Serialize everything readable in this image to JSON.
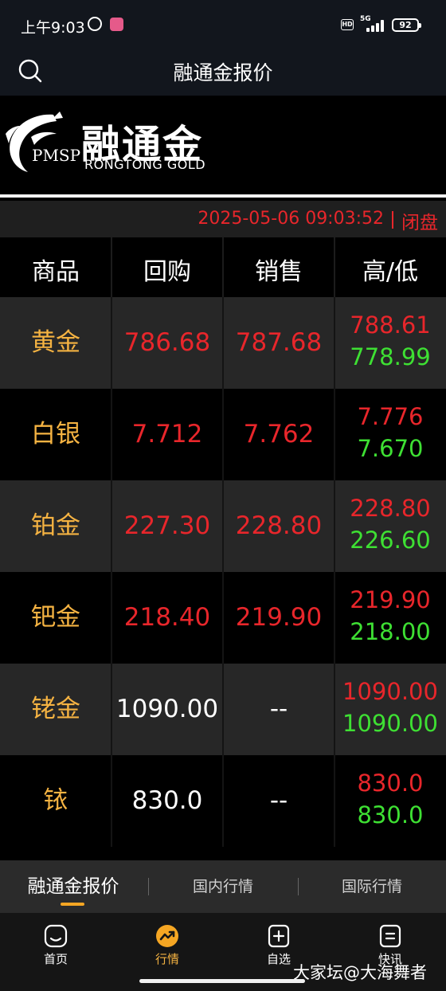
{
  "status_bar": {
    "time": "上午9:03",
    "network": "5G",
    "battery": "92",
    "icons": [
      "alarm-icon",
      "app-notification-icon",
      "hd-icon",
      "signal-icon",
      "battery-icon"
    ]
  },
  "header": {
    "title": "融通金报价",
    "search_icon": "search-icon"
  },
  "logo": {
    "pmsp": "PMSP",
    "name_cn": "融通金",
    "name_en": "RONGTONG  GOLD"
  },
  "update": {
    "timestamp": "2025-05-06 09:03:52",
    "status": "闭盘"
  },
  "table": {
    "headers": [
      "商品",
      "回购",
      "销售",
      "高/低"
    ],
    "rows": [
      {
        "name": "黄金",
        "buy": "786.68",
        "sell": "787.68",
        "high": "788.61",
        "low": "778.99"
      },
      {
        "name": "白银",
        "buy": "7.712",
        "sell": "7.762",
        "high": "7.776",
        "low": "7.670"
      },
      {
        "name": "铂金",
        "buy": "227.30",
        "sell": "228.80",
        "high": "228.80",
        "low": "226.60"
      },
      {
        "name": "钯金",
        "buy": "218.40",
        "sell": "219.90",
        "high": "219.90",
        "low": "218.00"
      },
      {
        "name": "铑金",
        "buy": "1090.00",
        "sell": "--",
        "high": "1090.00",
        "low": "1090.00"
      },
      {
        "name": "铱",
        "buy": "830.0",
        "sell": "--",
        "high": "830.0",
        "low": "830.0"
      }
    ]
  },
  "subtabs": [
    "融通金报价",
    "国内行情",
    "国际行情"
  ],
  "bottom_nav": [
    {
      "label": "首页",
      "icon": "home-icon"
    },
    {
      "label": "行情",
      "icon": "trend-icon"
    },
    {
      "label": "自选",
      "icon": "add-favorite-icon"
    },
    {
      "label": "快讯",
      "icon": "news-icon"
    }
  ],
  "watermark": "大家坛@大海舞者",
  "colors": {
    "up_red": "#e8262b",
    "down_green": "#3ee033",
    "accent_gold": "#f5b342"
  }
}
